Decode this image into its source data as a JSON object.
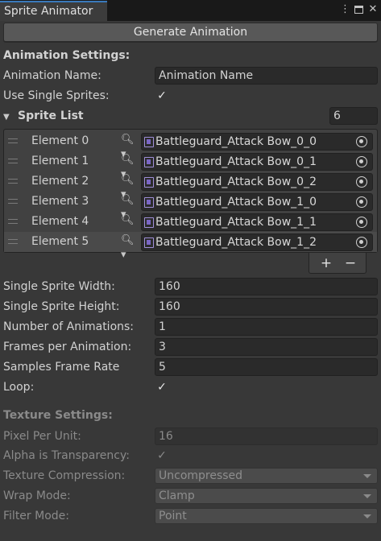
{
  "tab": {
    "title": "Sprite Animator"
  },
  "generate_button": "Generate Animation",
  "animation_settings": {
    "header": "Animation Settings:",
    "name_label": "Animation Name:",
    "name_value": "Animation Name",
    "single_sprites_label": "Use Single Sprites:",
    "single_sprites_checked": true
  },
  "sprite_list": {
    "label": "Sprite List",
    "count": "6",
    "items": [
      {
        "label": "Element 0",
        "value": "Battleguard_Attack Bow_0_0"
      },
      {
        "label": "Element 1",
        "value": "Battleguard_Attack Bow_0_1"
      },
      {
        "label": "Element 2",
        "value": "Battleguard_Attack Bow_0_2"
      },
      {
        "label": "Element 3",
        "value": "Battleguard_Attack Bow_1_0"
      },
      {
        "label": "Element 4",
        "value": "Battleguard_Attack Bow_1_1"
      },
      {
        "label": "Element 5",
        "value": "Battleguard_Attack Bow_1_2"
      }
    ],
    "add_label": "+",
    "remove_label": "−"
  },
  "sprite_fields": [
    {
      "label": "Single Sprite Width:",
      "value": "160"
    },
    {
      "label": "Single Sprite Height:",
      "value": "160"
    },
    {
      "label": "Number of Animations:",
      "value": "1"
    },
    {
      "label": "Frames per Animation:",
      "value": "3"
    },
    {
      "label": "Samples Frame Rate",
      "value": "5"
    }
  ],
  "loop": {
    "label": "Loop:",
    "checked": true
  },
  "texture_settings": {
    "header": "Texture Settings:",
    "ppu_label": "Pixel Per Unit:",
    "ppu_value": "16",
    "alpha_label": "Alpha is Transparency:",
    "alpha_checked": true,
    "compression_label": "Texture Compression:",
    "compression_value": "Uncompressed",
    "wrap_label": "Wrap Mode:",
    "wrap_value": "Clamp",
    "filter_label": "Filter Mode:",
    "filter_value": "Point"
  },
  "icons": {
    "check": "✓",
    "menu": "⋮",
    "close": "✕",
    "foldout": "▼",
    "picker": "🔍︎"
  }
}
